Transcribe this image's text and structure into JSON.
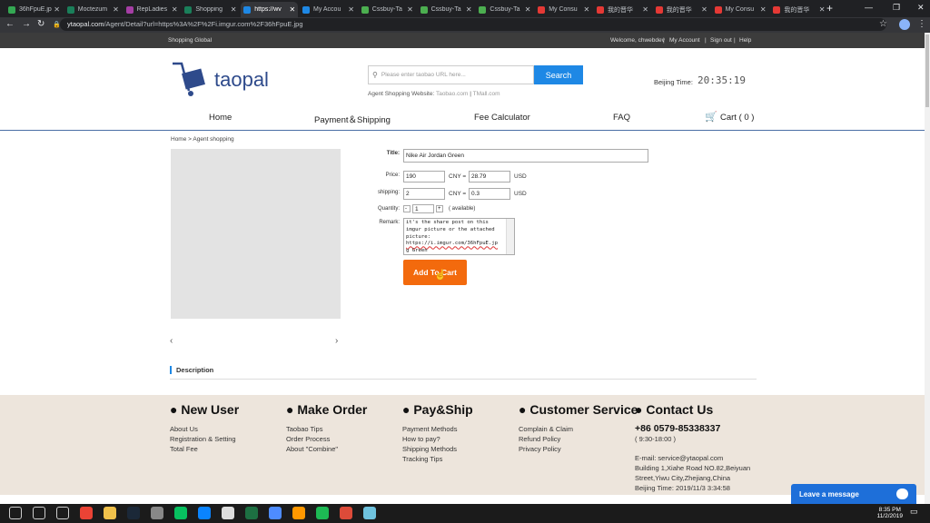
{
  "browser": {
    "tabs": [
      {
        "title": "36hFpuE.jp",
        "color": "#34a853"
      },
      {
        "title": "Moctezum",
        "color": "#1a7f5a"
      },
      {
        "title": "RepLadies",
        "color": "#a53ea5"
      },
      {
        "title": "Shopping",
        "color": "#1a7f5a"
      },
      {
        "title": "https://wv",
        "color": "#1e88e5"
      },
      {
        "title": "My Accou",
        "color": "#1e88e5"
      },
      {
        "title": "Cssbuy-Ta",
        "color": "#4caf50"
      },
      {
        "title": "Cssbuy-Ta",
        "color": "#4caf50"
      },
      {
        "title": "Cssbuy-Ta",
        "color": "#4caf50"
      },
      {
        "title": "My Consu",
        "color": "#e53935"
      },
      {
        "title": "我的晋华",
        "color": "#e53935"
      },
      {
        "title": "我的晋华",
        "color": "#e53935"
      },
      {
        "title": "My Consu",
        "color": "#e53935"
      },
      {
        "title": "我的晋华",
        "color": "#e53935"
      }
    ],
    "active_tab_index": 4,
    "url_host": "ytaopal.com",
    "url_path": "/Agent/Detail?url=https%3A%2F%2Fi.imgur.com%2F36hFpuE.jpg"
  },
  "topstrip": {
    "left": "Shopping Global",
    "welcome": "Welcome, chwebdev",
    "my_account": "My Account",
    "sign_out": "Sign out",
    "help": "Help",
    "sep": "|"
  },
  "header": {
    "brand": "taopal",
    "search_placeholder": "Please enter taobao URL here...",
    "search_button": "Search",
    "agent_label": "Agent Shopping Website:",
    "agent_link1": "Taobao.com",
    "agent_sep": "|",
    "agent_link2": "TMall.com",
    "beijing_label": "Beijing Time:",
    "beijing_time": "20:35:19"
  },
  "nav": {
    "home": "Home",
    "payment": "Payment＆Shipping",
    "fee": "Fee Calculator",
    "faq": "FAQ",
    "cart": "Cart ( 0 )"
  },
  "breadcrumb": "Home > Agent shopping",
  "form": {
    "title_label": "Title:",
    "title_value": "Nike Air Jordan Green",
    "price_label": "Price:",
    "price_value": "190",
    "cny_eq": "CNY =",
    "price_usd": "28.79",
    "usd": "USD",
    "shipping_label": "shipping:",
    "shipping_value": "2",
    "shipping_usd": "0.3",
    "quantity_label": "Quantity:",
    "qty_minus": "-",
    "qty_value": "1",
    "qty_plus": "+",
    "available": "( available)",
    "remark_label": "Remark:",
    "remark_lines": [
      "it's the share post on this",
      "imgur picture or the attached",
      "picture:",
      "https://i.imgur.com/36hFpuE.jp",
      "g Green"
    ],
    "add_to_cart": "Add To Cart"
  },
  "description_label": "Description",
  "footer": {
    "columns": [
      {
        "heading": "● New User",
        "links": [
          "About Us",
          "Registration & Setting",
          "Total Fee"
        ]
      },
      {
        "heading": "● Make Order",
        "links": [
          "Taobao Tips",
          "Order Process",
          "About \"Combine\""
        ]
      },
      {
        "heading": "● Pay&Ship",
        "links": [
          "Payment Methods",
          "How to pay?",
          "Shipping Methods",
          "Tracking Tips"
        ]
      },
      {
        "heading": "● Customer Service",
        "links": [
          "Complain & Claim",
          "Refund Policy",
          "Privacy Policy"
        ]
      }
    ],
    "contact_heading": "● Contact Us",
    "phone": "+86 0579-85338337",
    "hours": "( 9:30-18:00 )",
    "email": "E-mail: service@ytaopal.com",
    "address1": "Building 1,Xiahe Road NO.82,Beiyuan",
    "address2": "Street,Yiwu City,Zhejiang,China",
    "beijing_time": "Beijing Time: 2019/11/3 3:34:58"
  },
  "chat_widget": "Leave a message",
  "taskbar": {
    "time": "8:35 PM",
    "date": "11/2/2019",
    "icons": [
      "start-icon",
      "search-icon",
      "task-view-icon",
      "chrome-icon",
      "file-explorer-icon",
      "steam-icon",
      "settings-icon",
      "wechat-icon",
      "edge-icon",
      "photos-icon",
      "excel-icon",
      "network-icon",
      "sublime-icon",
      "spotify-icon",
      "chrome-alt-icon",
      "notes-icon"
    ]
  }
}
